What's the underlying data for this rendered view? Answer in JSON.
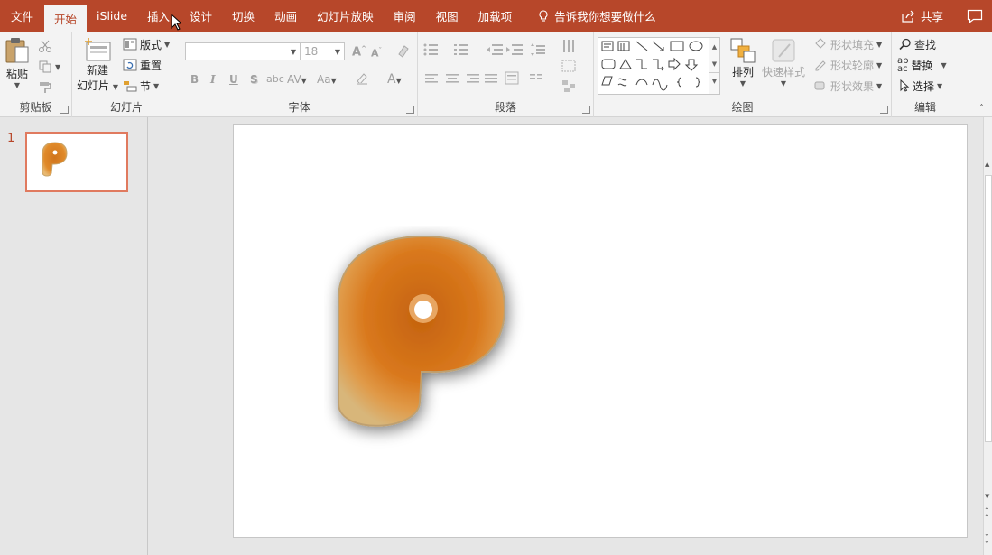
{
  "tabs": [
    "文件",
    "开始",
    "iSlide",
    "插入",
    "设计",
    "切换",
    "动画",
    "幻灯片放映",
    "审阅",
    "视图",
    "加载项"
  ],
  "active_tab_index": 1,
  "tell_me": "告诉我你想要做什么",
  "share_label": "共享",
  "clipboard": {
    "paste": "粘贴",
    "group_label": "剪贴板"
  },
  "slides": {
    "new_slide_line1": "新建",
    "new_slide_line2": "幻灯片",
    "layout": "版式",
    "reset": "重置",
    "section": "节",
    "group_label": "幻灯片"
  },
  "font": {
    "name": "",
    "size": "18",
    "group_label": "字体",
    "bold": "B",
    "italic": "I",
    "underline": "U",
    "shadow": "S",
    "strike": "abc",
    "spacing": "AV",
    "case": "Aa",
    "color": "A"
  },
  "paragraph": {
    "group_label": "段落"
  },
  "drawing": {
    "arrange": "排列",
    "quick_styles": "快速样式",
    "shape_fill": "形状填充",
    "shape_outline": "形状轮廓",
    "shape_effects": "形状效果",
    "group_label": "绘图"
  },
  "editing": {
    "find": "查找",
    "replace": "替换",
    "select": "选择",
    "group_label": "编辑"
  },
  "slide_panel": {
    "number": "1"
  },
  "colors": {
    "accent": "#b7472a",
    "thumb_border": "#e07a5f"
  }
}
